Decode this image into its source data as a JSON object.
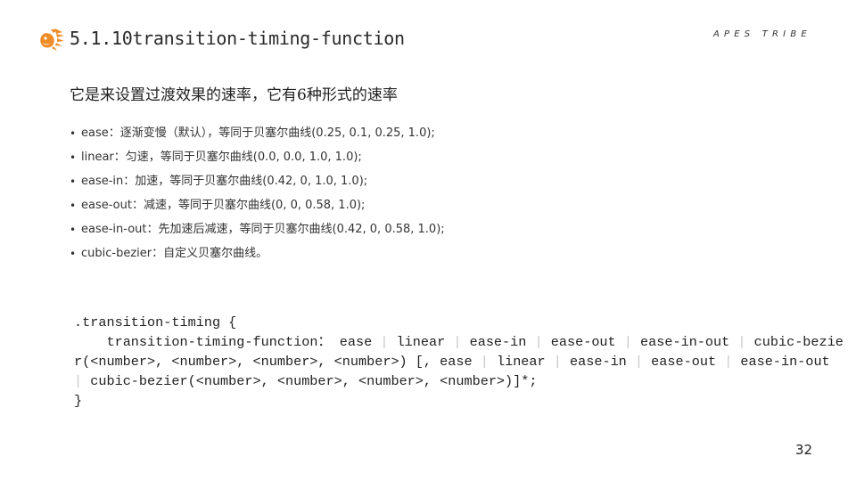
{
  "header": {
    "title": "5.1.10transition-timing-function",
    "brand": "APES TRIBE",
    "logo_icon": "lion-head-logo-icon",
    "accent_color": "#f08c28"
  },
  "intro": "它是来设置过渡效果的速率，它有6种形式的速率",
  "bullets": [
    {
      "text": "ease：逐渐变慢（默认），等同于贝塞尔曲线(0.25, 0.1, 0.25, 1.0);"
    },
    {
      "text": "linear：匀速，等同于贝塞尔曲线(0.0, 0.0, 1.0, 1.0);"
    },
    {
      "text": "ease-in：加速，等同于贝塞尔曲线(0.42, 0, 1.0, 1.0);"
    },
    {
      "text": "ease-out：减速，等同于贝塞尔曲线(0, 0, 0.58, 1.0);"
    },
    {
      "text": "ease-in-out：先加速后减速，等同于贝塞尔曲线(0.42, 0, 0.58, 1.0);"
    },
    {
      "text": "cubic-bezier：自定义贝塞尔曲线。"
    }
  ],
  "bullet_glyph": "•",
  "code": {
    "open": ".transition-timing {",
    "indent": "    ",
    "property": "transition-timing-function：",
    "values1": [
      "ease",
      "linear",
      "ease-in",
      "ease-out",
      "ease-in-out",
      "cubic-bezier(<number>, <number>, <number>, <number>)"
    ],
    "bracket_open": " [, ",
    "values2": [
      "ease",
      "linear",
      "ease-in",
      "ease-out",
      "ease-in-out",
      "cubic-bezier(<number>, <number>, <number>, <number>)"
    ],
    "bracket_close": "]*;",
    "close": "}",
    "separator": "|"
  },
  "page_number": "32"
}
